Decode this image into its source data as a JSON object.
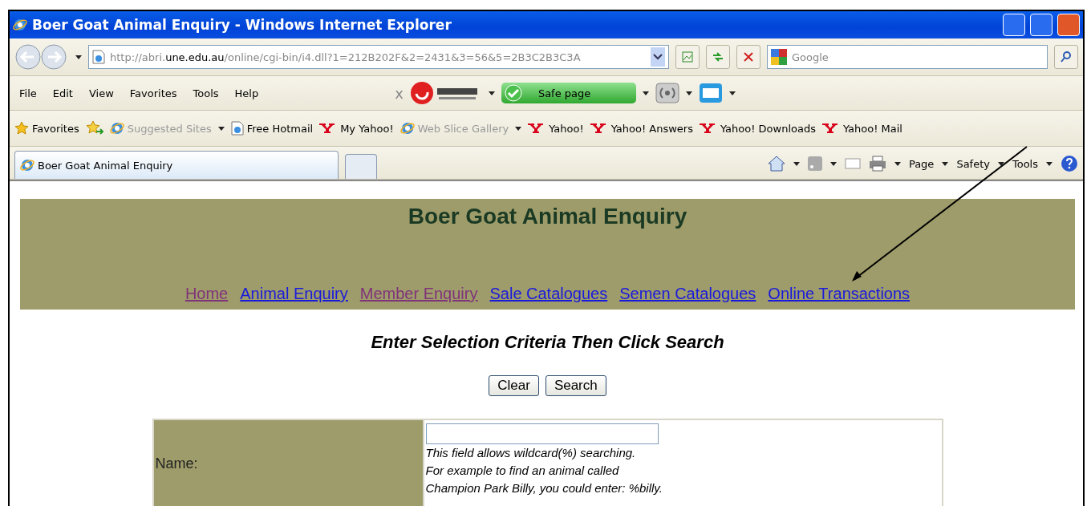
{
  "window": {
    "title": "Boer Goat Animal Enquiry - Windows Internet Explorer"
  },
  "address": {
    "url_prefix": "http://abri.",
    "url_domain": "une.edu.au",
    "url_path": "/online/cgi-bin/i4.dll?1=212B202F&2=2431&3=56&5=2B3C2B3C3A"
  },
  "search": {
    "placeholder": "Google"
  },
  "menu": [
    "File",
    "Edit",
    "View",
    "Favorites",
    "Tools",
    "Help"
  ],
  "toolbar": {
    "close": "x",
    "safe_label": "Safe page"
  },
  "favorites_bar": [
    {
      "label": "Favorites",
      "kind": "star",
      "disabled": false
    },
    {
      "label": "Suggested Sites",
      "kind": "ie",
      "disabled": true
    },
    {
      "label": "Free Hotmail",
      "kind": "page",
      "disabled": false
    },
    {
      "label": "My Yahoo!",
      "kind": "yahoo",
      "disabled": false
    },
    {
      "label": "Web Slice Gallery",
      "kind": "ie",
      "disabled": true
    },
    {
      "label": "Yahoo!",
      "kind": "yahoo",
      "disabled": false
    },
    {
      "label": "Yahoo! Answers",
      "kind": "yahoo",
      "disabled": false
    },
    {
      "label": "Yahoo! Downloads",
      "kind": "yahoo",
      "disabled": false
    },
    {
      "label": "Yahoo! Mail",
      "kind": "yahoo",
      "disabled": false
    }
  ],
  "tabs": [
    {
      "label": "Boer Goat Animal Enquiry",
      "selected": true
    }
  ],
  "command_bar": [
    "Page",
    "Safety",
    "Tools"
  ],
  "page": {
    "title": "Boer Goat Animal Enquiry",
    "nav": [
      {
        "label": "Home",
        "visited": true
      },
      {
        "label": "Animal Enquiry",
        "visited": false
      },
      {
        "label": "Member Enquiry",
        "visited": true
      },
      {
        "label": "Sale Catalogues",
        "visited": false
      },
      {
        "label": "Semen Catalogues",
        "visited": false
      },
      {
        "label": "Online Transactions",
        "visited": false
      }
    ],
    "heading": "Enter Selection Criteria Then Click Search",
    "buttons": [
      "Clear",
      "Search"
    ],
    "form": [
      {
        "label": "Name:",
        "hint": [
          "This field allows wildcard(%) searching.",
          "For example to find an animal called",
          "Champion Park Billy, you could enter: %billy."
        ]
      }
    ]
  }
}
